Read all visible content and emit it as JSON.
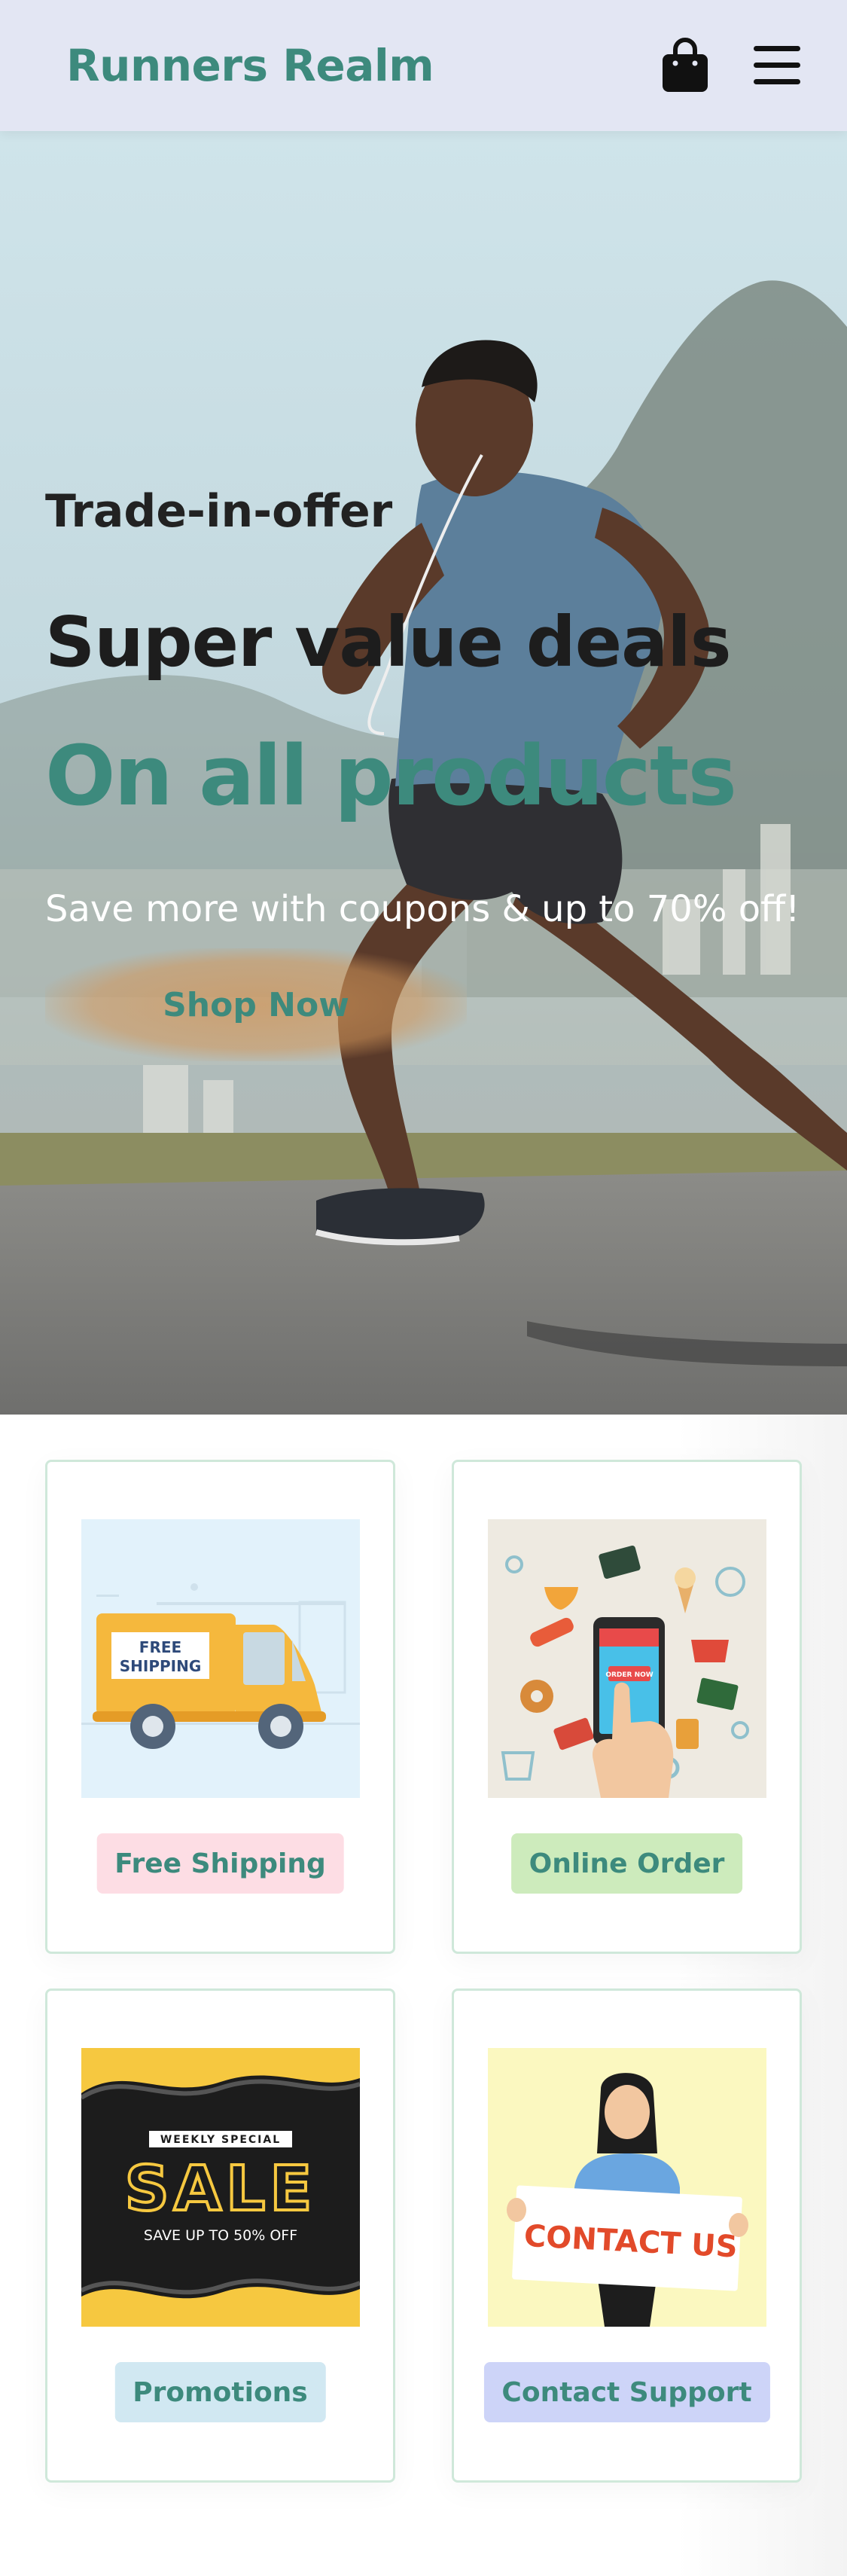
{
  "header": {
    "logo": "Runners Realm",
    "icons": [
      "shopping-bag-icon",
      "hamburger-menu-icon"
    ]
  },
  "hero": {
    "kicker": "Trade-in-offer",
    "title": "Super value deals",
    "title_accent": "On all products",
    "subtitle": "Save more with coupons & up to 70% off!",
    "button_label": "Shop Now"
  },
  "features": [
    {
      "label": "Free Shipping",
      "tag_color": "#fddde4",
      "image": {
        "kind": "truck",
        "sign_line1": "FREE",
        "sign_line2": "SHIPPING"
      }
    },
    {
      "label": "Online Order",
      "tag_color": "#cdebbc",
      "image": {
        "kind": "phone",
        "screen_text": "ORDER NOW"
      }
    },
    {
      "label": "Promotions",
      "tag_color": "#d1e8f2",
      "image": {
        "kind": "sale",
        "top_text": "WEEKLY SPECIAL",
        "main_text": "SALE",
        "bottom_text": "SAVE UP TO 50% OFF"
      }
    },
    {
      "label": "Contact Support",
      "tag_color": "#cdd4f8",
      "image": {
        "kind": "contact",
        "sign_text": "CONTACT US"
      }
    }
  ],
  "colors": {
    "brand": "#3d8a7d",
    "header_bg": "#e3e6f3"
  }
}
